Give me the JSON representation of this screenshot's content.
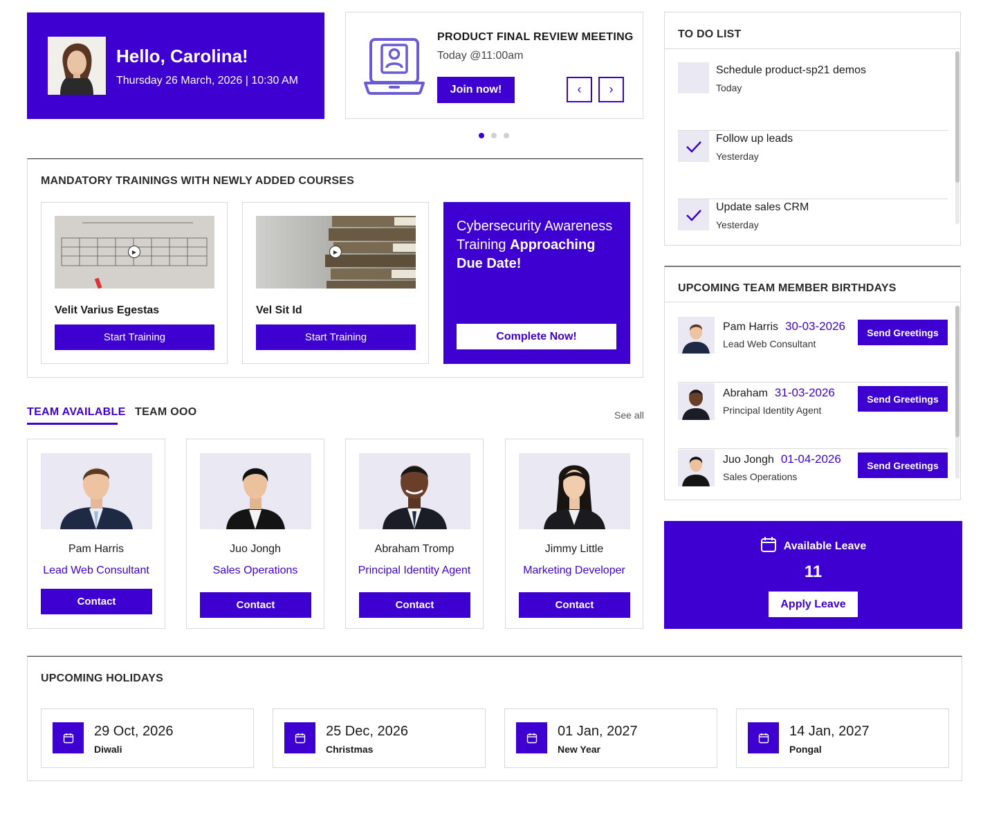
{
  "colors": {
    "accent": "#3d00d1",
    "muted": "#e9e8f3"
  },
  "greeting": {
    "title": "Hello, Carolina!",
    "datetime": "Thursday 26 March, 2026 | 10:30 AM"
  },
  "meeting": {
    "title": "PRODUCT FINAL REVIEW MEETING",
    "time": "Today @11:00am",
    "join_label": "Join now!",
    "prev_icon": "‹",
    "next_icon": "›",
    "icon": "laptop-user-icon"
  },
  "trainings": {
    "title": "MANDATORY TRAININGS WITH NEWLY ADDED COURSES",
    "courses": [
      {
        "name": "Velit Varius Egestas",
        "button": "Start Training"
      },
      {
        "name": "Vel Sit Id",
        "button": "Start Training"
      }
    ],
    "promo": {
      "text_light": "Cybersecurity Awareness Training ",
      "text_bold": "Approaching Due Date!",
      "button": "Complete Now!"
    }
  },
  "team": {
    "tabs": [
      {
        "label": "TEAM AVAILABLE",
        "active": true
      },
      {
        "label": "TEAM OOO",
        "active": false
      }
    ],
    "see_all": "See all",
    "members": [
      {
        "name": "Pam Harris",
        "role": "Lead Web Consultant",
        "button": "Contact"
      },
      {
        "name": "Juo Jongh",
        "role": "Sales Operations",
        "button": "Contact"
      },
      {
        "name": "Abraham Tromp",
        "role": "Principal Identity Agent",
        "button": "Contact"
      },
      {
        "name": "Jimmy Little",
        "role": "Marketing Developer",
        "button": "Contact"
      }
    ]
  },
  "todo": {
    "title": "TO DO LIST",
    "items": [
      {
        "task": "Schedule product-sp21 demos",
        "when": "Today",
        "done": false
      },
      {
        "task": "Follow up leads",
        "when": "Yesterday",
        "done": true
      },
      {
        "task": "Update sales CRM",
        "when": "Yesterday",
        "done": true
      }
    ]
  },
  "birthdays": {
    "title": "UPCOMING TEAM MEMBER BIRTHDAYS",
    "items": [
      {
        "name": "Pam Harris",
        "date": "30-03-2026",
        "role": "Lead Web Consultant",
        "button": "Send Greetings"
      },
      {
        "name": "Abraham",
        "date": "31-03-2026",
        "role": "Principal Identity Agent",
        "button": "Send Greetings"
      },
      {
        "name": "Juo Jongh",
        "date": "01-04-2026",
        "role": "Sales Operations",
        "button": "Send Greetings"
      }
    ]
  },
  "leave": {
    "label": "Available Leave",
    "count": "11",
    "button": "Apply Leave",
    "icon": "calendar-icon"
  },
  "holidays": {
    "title": "UPCOMING HOLIDAYS",
    "items": [
      {
        "date": "29 Oct, 2026",
        "name": "Diwali"
      },
      {
        "date": "25 Dec, 2026",
        "name": "Christmas"
      },
      {
        "date": "01 Jan, 2027",
        "name": "New Year"
      },
      {
        "date": "14 Jan, 2027",
        "name": "Pongal"
      }
    ]
  }
}
